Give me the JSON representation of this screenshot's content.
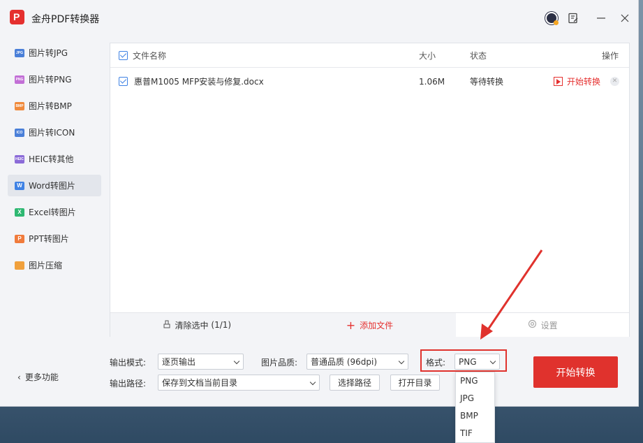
{
  "app": {
    "title": "金舟PDF转换器"
  },
  "sidebar": {
    "items": [
      {
        "label": "图片转JPG",
        "icon_text": "JPG",
        "color": "#4a7fd8"
      },
      {
        "label": "图片转PNG",
        "icon_text": "PNG",
        "color": "#c26fd6"
      },
      {
        "label": "图片转BMP",
        "icon_text": "BMP",
        "color": "#f08a3c"
      },
      {
        "label": "图片转ICON",
        "icon_text": "ICO",
        "color": "#4a7fd8"
      },
      {
        "label": "HEIC转其他",
        "icon_text": "HEIC",
        "color": "#8b6bd8"
      },
      {
        "label": "Word转图片",
        "icon_text": "W",
        "color": "#3f82e4",
        "active": true
      },
      {
        "label": "Excel转图片",
        "icon_text": "X",
        "color": "#2eb872"
      },
      {
        "label": "PPT转图片",
        "icon_text": "P",
        "color": "#f07b3c"
      },
      {
        "label": "图片压缩",
        "icon_text": "",
        "color": "#f0a03c"
      }
    ],
    "more_label": "更多功能"
  },
  "table": {
    "headers": {
      "name": "文件名称",
      "size": "大小",
      "status": "状态",
      "ops": "操作"
    },
    "rows": [
      {
        "name": "惠普M1005 MFP安装与修复.docx",
        "size": "1.06M",
        "status": "等待转换",
        "op_label": "开始转换"
      }
    ]
  },
  "bottom_bar": {
    "clear_label": "清除选中",
    "clear_count": "(1/1)",
    "add_label": "添加文件",
    "settings_label": "设置"
  },
  "options": {
    "output_mode_label": "输出模式:",
    "output_mode_value": "逐页输出",
    "quality_label": "图片品质:",
    "quality_value": "普通品质 (96dpi)",
    "format_label": "格式:",
    "format_value": "PNG",
    "path_label": "输出路径:",
    "path_value": "保存到文档当前目录",
    "choose_path_label": "选择路径",
    "open_dir_label": "打开目录",
    "start_label": "开始转换"
  },
  "format_dropdown": {
    "options": [
      "PNG",
      "JPG",
      "BMP",
      "TIF"
    ]
  },
  "colors": {
    "accent": "#e0322d",
    "checkbox": "#3f82e4"
  }
}
